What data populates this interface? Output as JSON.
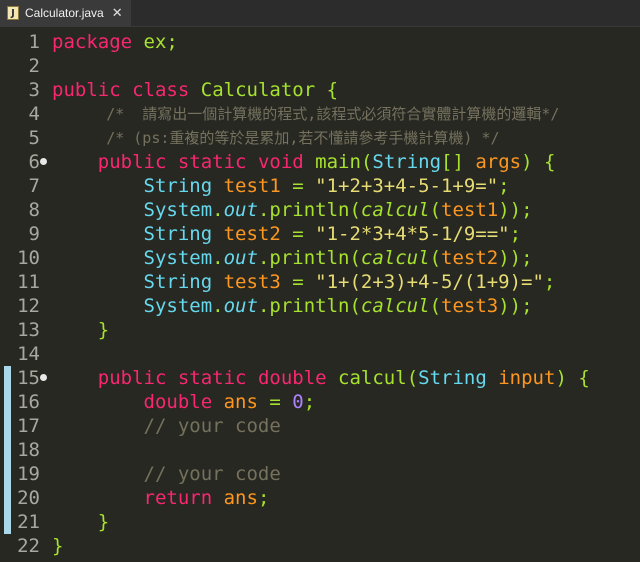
{
  "tab": {
    "title": "Calculator.java",
    "icon": "java-file-icon",
    "close": "✕"
  },
  "lines": [
    {
      "n": "1",
      "fold": false,
      "tokens": [
        [
          "kw",
          "package"
        ],
        [
          "pl",
          " ex;"
        ]
      ]
    },
    {
      "n": "2",
      "fold": false,
      "tokens": []
    },
    {
      "n": "3",
      "fold": false,
      "tokens": [
        [
          "kw",
          "public"
        ],
        [
          "pl",
          " "
        ],
        [
          "kw",
          "class"
        ],
        [
          "pl",
          " "
        ],
        [
          "cls",
          "Calculator"
        ],
        [
          "pl",
          " {"
        ]
      ]
    },
    {
      "n": "4",
      "fold": false,
      "small": true,
      "tokens": [
        [
          "pl",
          "      "
        ],
        [
          "cm",
          "/*  請寫出一個計算機的程式,該程式必須符合實體計算機的邏輯*/"
        ]
      ]
    },
    {
      "n": "5",
      "fold": false,
      "small": true,
      "tokens": [
        [
          "pl",
          "      "
        ],
        [
          "cm",
          "/* (ps:重複的等於是累加,若不懂請參考手機計算機) */"
        ]
      ]
    },
    {
      "n": "6",
      "fold": true,
      "tokens": [
        [
          "pl",
          "    "
        ],
        [
          "kw",
          "public"
        ],
        [
          "pl",
          " "
        ],
        [
          "kw",
          "static"
        ],
        [
          "pl",
          " "
        ],
        [
          "kw",
          "void"
        ],
        [
          "pl",
          " "
        ],
        [
          "cls",
          "main"
        ],
        [
          "pl",
          "("
        ],
        [
          "ty",
          "String"
        ],
        [
          "pl",
          "[] "
        ],
        [
          "var",
          "args"
        ],
        [
          "pl",
          ") {"
        ]
      ]
    },
    {
      "n": "7",
      "fold": false,
      "tokens": [
        [
          "pl",
          "        "
        ],
        [
          "ty",
          "String"
        ],
        [
          "pl",
          " "
        ],
        [
          "var",
          "test1"
        ],
        [
          "pl",
          " = "
        ],
        [
          "str",
          "\"1+2+3+4-5-1+9=\""
        ],
        [
          "pl",
          ";"
        ]
      ]
    },
    {
      "n": "8",
      "fold": false,
      "tokens": [
        [
          "pl",
          "        "
        ],
        [
          "ty",
          "System"
        ],
        [
          "pl",
          "."
        ],
        [
          "it",
          "out"
        ],
        [
          "pl",
          "."
        ],
        [
          "cls",
          "println"
        ],
        [
          "pl",
          "("
        ],
        [
          "fn",
          "calcul"
        ],
        [
          "pl",
          "("
        ],
        [
          "var",
          "test1"
        ],
        [
          "pl",
          "));"
        ]
      ]
    },
    {
      "n": "9",
      "fold": false,
      "tokens": [
        [
          "pl",
          "        "
        ],
        [
          "ty",
          "String"
        ],
        [
          "pl",
          " "
        ],
        [
          "var",
          "test2"
        ],
        [
          "pl",
          " = "
        ],
        [
          "str",
          "\"1-2*3+4*5-1/9==\""
        ],
        [
          "pl",
          ";"
        ]
      ]
    },
    {
      "n": "10",
      "fold": false,
      "tokens": [
        [
          "pl",
          "        "
        ],
        [
          "ty",
          "System"
        ],
        [
          "pl",
          "."
        ],
        [
          "it",
          "out"
        ],
        [
          "pl",
          "."
        ],
        [
          "cls",
          "println"
        ],
        [
          "pl",
          "("
        ],
        [
          "fn",
          "calcul"
        ],
        [
          "pl",
          "("
        ],
        [
          "var",
          "test2"
        ],
        [
          "pl",
          "));"
        ]
      ]
    },
    {
      "n": "11",
      "fold": false,
      "tokens": [
        [
          "pl",
          "        "
        ],
        [
          "ty",
          "String"
        ],
        [
          "pl",
          " "
        ],
        [
          "var",
          "test3"
        ],
        [
          "pl",
          " = "
        ],
        [
          "str",
          "\"1+(2+3)+4-5/(1+9)=\""
        ],
        [
          "pl",
          ";"
        ]
      ]
    },
    {
      "n": "12",
      "fold": false,
      "tokens": [
        [
          "pl",
          "        "
        ],
        [
          "ty",
          "System"
        ],
        [
          "pl",
          "."
        ],
        [
          "it",
          "out"
        ],
        [
          "pl",
          "."
        ],
        [
          "cls",
          "println"
        ],
        [
          "pl",
          "("
        ],
        [
          "fn",
          "calcul"
        ],
        [
          "pl",
          "("
        ],
        [
          "var",
          "test3"
        ],
        [
          "pl",
          "));"
        ]
      ]
    },
    {
      "n": "13",
      "fold": false,
      "tokens": [
        [
          "pl",
          "    }"
        ]
      ]
    },
    {
      "n": "14",
      "fold": false,
      "tokens": []
    },
    {
      "n": "15",
      "fold": true,
      "tokens": [
        [
          "pl",
          "    "
        ],
        [
          "kw",
          "public"
        ],
        [
          "pl",
          " "
        ],
        [
          "kw",
          "static"
        ],
        [
          "pl",
          " "
        ],
        [
          "kw",
          "double"
        ],
        [
          "pl",
          " "
        ],
        [
          "cls",
          "calcul"
        ],
        [
          "pl",
          "("
        ],
        [
          "ty",
          "String"
        ],
        [
          "pl",
          " "
        ],
        [
          "var",
          "input"
        ],
        [
          "pl",
          ") {"
        ]
      ]
    },
    {
      "n": "16",
      "fold": false,
      "tokens": [
        [
          "pl",
          "        "
        ],
        [
          "kw",
          "double"
        ],
        [
          "pl",
          " "
        ],
        [
          "var",
          "ans"
        ],
        [
          "pl",
          " = "
        ],
        [
          "num",
          "0"
        ],
        [
          "pl",
          ";"
        ]
      ]
    },
    {
      "n": "17",
      "fold": false,
      "tokens": [
        [
          "pl",
          "        "
        ],
        [
          "cm",
          "// your code"
        ]
      ]
    },
    {
      "n": "18",
      "fold": false,
      "tokens": []
    },
    {
      "n": "19",
      "fold": false,
      "tokens": [
        [
          "pl",
          "        "
        ],
        [
          "cm",
          "// your code"
        ]
      ]
    },
    {
      "n": "20",
      "fold": false,
      "tokens": [
        [
          "pl",
          "        "
        ],
        [
          "kw",
          "return"
        ],
        [
          "pl",
          " "
        ],
        [
          "var",
          "ans"
        ],
        [
          "pl",
          ";"
        ]
      ]
    },
    {
      "n": "21",
      "fold": false,
      "tokens": [
        [
          "pl",
          "    }"
        ]
      ]
    },
    {
      "n": "22",
      "fold": false,
      "tokens": [
        [
          "pl",
          "}"
        ]
      ]
    }
  ],
  "change_bar": {
    "from_line": 15,
    "to_line": 21,
    "color": "#a8d8ea"
  },
  "colors": {
    "background": "#272822",
    "keyword": "#f92672",
    "type": "#66d9ef",
    "string": "#e6db74",
    "comment": "#75715e",
    "variable": "#fd971f",
    "method": "#a6e22e",
    "number": "#ae81ff"
  }
}
